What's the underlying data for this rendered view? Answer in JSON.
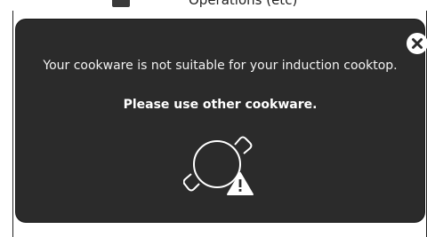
{
  "header_snippet": {
    "text": "Operations (etc)"
  },
  "dialog": {
    "message": "Your cookware is not suitable for your induction cooktop.",
    "instruction": "Please use other cookware.",
    "close_icon": "close-icon",
    "cookware_icon": "pan-warning-icon"
  },
  "colors": {
    "dialog_background": "#2b2b2b",
    "text": "#ffffff",
    "close_circle": "#ffffff"
  }
}
